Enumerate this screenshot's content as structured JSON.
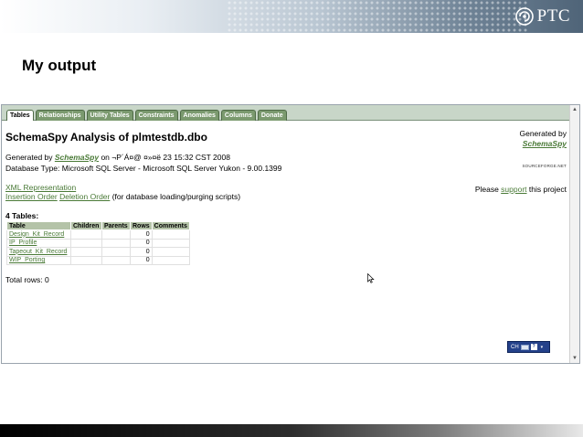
{
  "slide": {
    "title": "My output",
    "logo_text": "PTC"
  },
  "tabs": [
    "Tables",
    "Relationships",
    "Utility Tables",
    "Constraints",
    "Anomalies",
    "Columns",
    "Donate"
  ],
  "active_tab": "Tables",
  "page": {
    "heading": "SchemaSpy Analysis of plmtestdb.dbo",
    "generated_by_right": "Generated by",
    "brand_right": "SchemaSpy",
    "sourceforge_badge": "SOURCEFORGE.NET",
    "generated_prefix": "Generated by ",
    "brand": "SchemaSpy",
    "generated_suffix": " on ¬P´Á¤@ ¤»¤ë 23 15:32 CST 2008",
    "db_type": "Database Type: Microsoft SQL Server - Microsoft SQL Server Yukon - 9.00.1399",
    "xml_link": "XML Representation",
    "insertion_link": "Insertion Order",
    "deletion_link": "Deletion Order",
    "order_note": " (for database loading/purging scripts)",
    "please_prefix": "Please ",
    "support_link": "support",
    "please_suffix": " this project",
    "tables_heading": "4 Tables:",
    "total_rows": "Total rows: 0"
  },
  "table": {
    "headers": [
      "Table",
      "Children",
      "Parents",
      "Rows",
      "Comments"
    ],
    "rows": [
      {
        "name": "Design_Kit_Record",
        "children": "",
        "parents": "",
        "rows": "0",
        "comments": ""
      },
      {
        "name": "IP_Profile",
        "children": "",
        "parents": "",
        "rows": "0",
        "comments": ""
      },
      {
        "name": "Tapeout_Kit_Record",
        "children": "",
        "parents": "",
        "rows": "0",
        "comments": ""
      },
      {
        "name": "WIP_Porting",
        "children": "",
        "parents": "",
        "rows": "0",
        "comments": ""
      }
    ]
  },
  "language_bar": {
    "code": "CH"
  },
  "colors": {
    "link": "#4a7a37",
    "tab_bg": "#7b9a6f",
    "table_header": "#b4c3a8",
    "language_bar": "#24418a"
  },
  "icons": [
    "ptc-logo-icon",
    "scroll-up-icon",
    "scroll-down-icon",
    "mouse-cursor-icon",
    "keyboard-icon",
    "help-icon"
  ]
}
